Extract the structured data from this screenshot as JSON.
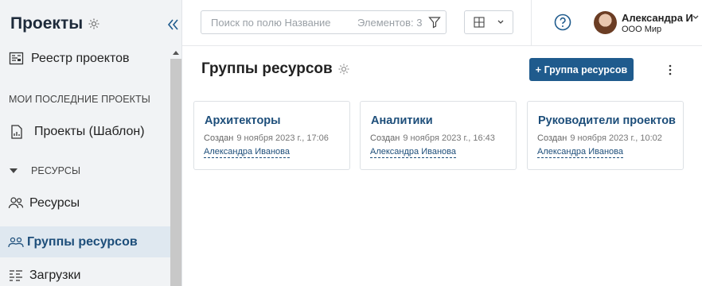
{
  "sidebar": {
    "title": "Проекты",
    "items": [
      {
        "label": "Реестр проектов",
        "icon": "registry-icon"
      },
      {
        "label": "Проекты (Шаблон)",
        "icon": "document-chart-icon"
      },
      {
        "label": "Ресурсы",
        "icon": "users-icon"
      },
      {
        "label": "Группы ресурсов",
        "icon": "users-group-icon",
        "active": true
      },
      {
        "label": "Загрузки",
        "icon": "workload-icon"
      }
    ],
    "sections": {
      "recent": "МОИ ПОСЛЕДНИЕ ПРОЕКТЫ",
      "resources": "РЕСУРСЫ"
    }
  },
  "topbar": {
    "search_placeholder": "Поиск по полю Название",
    "count_text": "Элементов: 3",
    "user": {
      "name": "Александра И",
      "org": "ООО Мир"
    }
  },
  "main": {
    "title": "Группы ресурсов",
    "add_button": "+ Группа ресурсов",
    "cards": [
      {
        "title": "Архитекторы",
        "created_label": "Создан",
        "date": "9 ноября 2023 г., 17:06",
        "author": "Александра Иванова"
      },
      {
        "title": "Аналитики",
        "created_label": "Создан",
        "date": "9 ноября 2023 г., 16:43",
        "author": "Александра Иванова"
      },
      {
        "title": "Руководители проектов",
        "created_label": "Создан",
        "date": "9 ноября 2023 г., 10:02",
        "author": "Александра Иванова"
      }
    ]
  },
  "colors": {
    "accent": "#1f5b8d",
    "link": "#1d4e7a",
    "sidebar_bg": "#f1f3f5",
    "active_bg": "#dfe8f0"
  }
}
